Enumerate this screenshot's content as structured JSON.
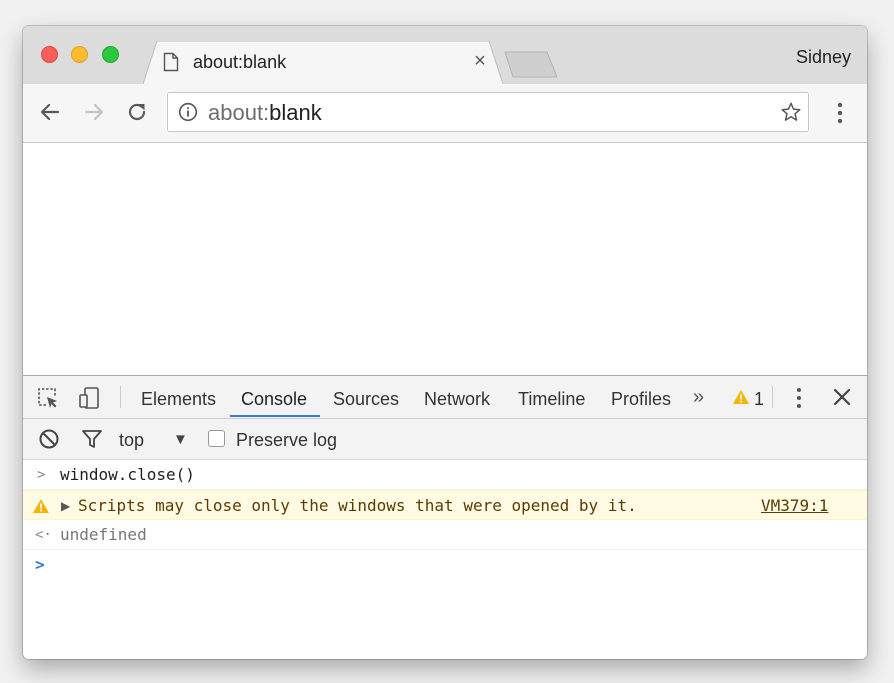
{
  "browser": {
    "tab": {
      "title": "about:blank",
      "close_glyph": "×"
    },
    "profile_name": "Sidney",
    "omnibox": {
      "scheme_text": "about:",
      "path_text": "blank"
    },
    "icons": {
      "tab": "file-icon",
      "back": "arrow-left-icon",
      "forward": "arrow-right-icon",
      "reload": "reload-icon",
      "info": "info-icon",
      "bookmark": "star-icon",
      "menu": "kebab-menu-icon"
    }
  },
  "devtools": {
    "tabs": [
      {
        "label": "Elements"
      },
      {
        "label": "Console"
      },
      {
        "label": "Sources"
      },
      {
        "label": "Network"
      },
      {
        "label": "Timeline"
      },
      {
        "label": "Profiles"
      }
    ],
    "active_tab": "Console",
    "more_glyph": "»",
    "warning_count": "1",
    "close_glyph": "✕",
    "accent_color": "#3879d9",
    "console_toolbar": {
      "context": "top",
      "caret": "▼",
      "preserve_log_label": "Preserve log",
      "preserve_log_checked": false
    },
    "messages": [
      {
        "type": "input",
        "glyph": ">",
        "text": "window.close()"
      },
      {
        "type": "warning",
        "expand_glyph": "▶",
        "text": "Scripts may close only the windows that were opened by it.",
        "source": "VM379:1"
      },
      {
        "type": "result",
        "glyph": "<·",
        "text": "undefined"
      }
    ],
    "prompt_glyph": ">"
  }
}
